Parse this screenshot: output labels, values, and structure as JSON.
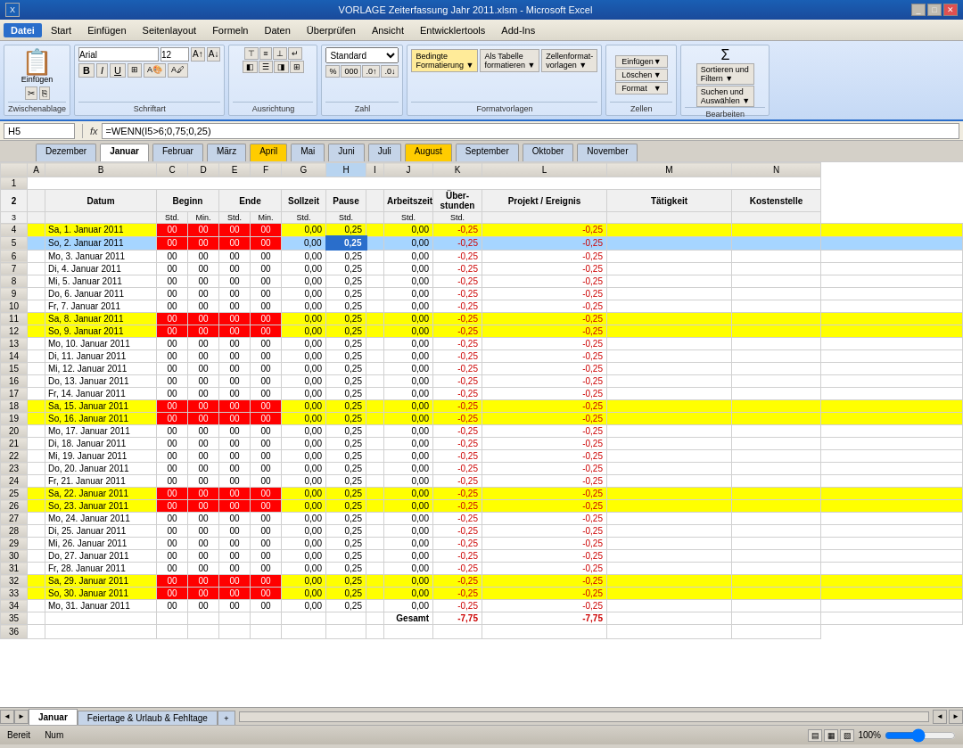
{
  "titleBar": {
    "title": "VORLAGE Zeiterfassung Jahr 2011.xlsm - Microsoft Excel",
    "controls": [
      "_",
      "□",
      "✕"
    ]
  },
  "menuBar": {
    "items": [
      "Datei",
      "Start",
      "Einfügen",
      "Seitenlayout",
      "Formeln",
      "Daten",
      "Überprüfen",
      "Ansicht",
      "Entwicklertools",
      "Add-Ins"
    ],
    "activeItem": "Datei"
  },
  "ribbonGroups": [
    {
      "label": "Zwischenablage",
      "buttons": [
        "Einfügen",
        "Ausschneiden",
        "Kopieren"
      ]
    },
    {
      "label": "Schriftart",
      "buttons": [
        "Arial",
        "12"
      ]
    },
    {
      "label": "Ausrichtung"
    },
    {
      "label": "Zahl",
      "buttons": [
        "Standard"
      ]
    },
    {
      "label": "Formatvorlagen",
      "buttons": [
        "Bedingte Formatierung",
        "Als Tabelle formatieren",
        "Zellenformatvorlagen"
      ]
    },
    {
      "label": "Zellen",
      "buttons": [
        "Einfügen",
        "Löschen",
        "Format"
      ]
    },
    {
      "label": "Bearbeiten",
      "buttons": [
        "Sortieren und Filtern",
        "Suchen und Auswählen"
      ]
    }
  ],
  "formulaBar": {
    "nameBox": "H5",
    "formula": "=WENN(I5>6;0,75;0,25)"
  },
  "innerTabs": [
    {
      "label": "Dezember",
      "active": false
    },
    {
      "label": "Januar",
      "active": true
    },
    {
      "label": "Februar",
      "active": false
    },
    {
      "label": "März",
      "active": false
    },
    {
      "label": "April",
      "active": false,
      "highlight": true
    },
    {
      "label": "Mai",
      "active": false
    },
    {
      "label": "Juni",
      "active": false
    },
    {
      "label": "Juli",
      "active": false
    },
    {
      "label": "August",
      "active": false,
      "highlight": true
    },
    {
      "label": "September",
      "active": false
    },
    {
      "label": "Oktober",
      "active": false
    },
    {
      "label": "November",
      "active": false
    }
  ],
  "columns": {
    "rowNum": "#",
    "a": "A",
    "b": "B",
    "c": "C",
    "d": "D",
    "e": "E",
    "f": "F",
    "g": "G",
    "h": "H",
    "i": "I",
    "j": "J",
    "k": "K",
    "l": "L",
    "m": "M",
    "n": "N"
  },
  "tableHeaders": {
    "row1": {
      "datum": "Datum",
      "beginn": "Beginn",
      "ende": "Ende",
      "sollzeit": "Sollzeit",
      "pause": "Pause",
      "arbeitszeit": "Arbeitszeit",
      "ueberstunden": "Über-stunden",
      "projekt": "Projekt / Ereignis",
      "taetigkeit": "Tätigkeit",
      "kostenstelle": "Kostenstelle"
    },
    "row2": {
      "std1": "Std.",
      "min1": "Min.",
      "std2": "Std.",
      "min2": "Min.",
      "std3": "Std.",
      "pause_std": "Std.",
      "arb_std": "Std.",
      "ueber_std": "Std."
    }
  },
  "rows": [
    {
      "num": 4,
      "datum": "Sa, 1. Januar 2011",
      "b": "00",
      "c": "00",
      "d": "00",
      "e": "00",
      "f": "0,00",
      "g": "0,25",
      "h": "0,00",
      "i": "-0,25",
      "j": "-0,25",
      "type": "yellow"
    },
    {
      "num": 5,
      "datum": "So, 2. Januar 2011",
      "b": "00",
      "c": "00",
      "d": "00",
      "e": "00",
      "f": "0,00",
      "g": "0,25",
      "h": "0,00",
      "i": "-0,25",
      "j": "-0,25",
      "type": "selected"
    },
    {
      "num": 6,
      "datum": "Mo, 3. Januar 2011",
      "b": "00",
      "c": "00",
      "d": "00",
      "e": "00",
      "f": "0,00",
      "g": "0,25",
      "h": "0,00",
      "i": "-0,25",
      "j": "-0,25",
      "type": "normal"
    },
    {
      "num": 7,
      "datum": "Di, 4. Januar 2011",
      "b": "00",
      "c": "00",
      "d": "00",
      "e": "00",
      "f": "0,00",
      "g": "0,25",
      "h": "0,00",
      "i": "-0,25",
      "j": "-0,25",
      "type": "normal"
    },
    {
      "num": 8,
      "datum": "Mi, 5. Januar 2011",
      "b": "00",
      "c": "00",
      "d": "00",
      "e": "00",
      "f": "0,00",
      "g": "0,25",
      "h": "0,00",
      "i": "-0,25",
      "j": "-0,25",
      "type": "normal"
    },
    {
      "num": 9,
      "datum": "Do, 6. Januar 2011",
      "b": "00",
      "c": "00",
      "d": "00",
      "e": "00",
      "f": "0,00",
      "g": "0,25",
      "h": "0,00",
      "i": "-0,25",
      "j": "-0,25",
      "type": "normal"
    },
    {
      "num": 10,
      "datum": "Fr, 7. Januar 2011",
      "b": "00",
      "c": "00",
      "d": "00",
      "e": "00",
      "f": "0,00",
      "g": "0,25",
      "h": "0,00",
      "i": "-0,25",
      "j": "-0,25",
      "type": "normal"
    },
    {
      "num": 11,
      "datum": "Sa, 8. Januar 2011",
      "b": "00",
      "c": "00",
      "d": "00",
      "e": "00",
      "f": "0,00",
      "g": "0,25",
      "h": "0,00",
      "i": "-0,25",
      "j": "-0,25",
      "type": "yellow"
    },
    {
      "num": 12,
      "datum": "So, 9. Januar 2011",
      "b": "00",
      "c": "00",
      "d": "00",
      "e": "00",
      "f": "0,00",
      "g": "0,25",
      "h": "0,00",
      "i": "-0,25",
      "j": "-0,25",
      "type": "yellow"
    },
    {
      "num": 13,
      "datum": "Mo, 10. Januar 2011",
      "b": "00",
      "c": "00",
      "d": "00",
      "e": "00",
      "f": "0,00",
      "g": "0,25",
      "h": "0,00",
      "i": "-0,25",
      "j": "-0,25",
      "type": "normal"
    },
    {
      "num": 14,
      "datum": "Di, 11. Januar 2011",
      "b": "00",
      "c": "00",
      "d": "00",
      "e": "00",
      "f": "0,00",
      "g": "0,25",
      "h": "0,00",
      "i": "-0,25",
      "j": "-0,25",
      "type": "normal"
    },
    {
      "num": 15,
      "datum": "Mi, 12. Januar 2011",
      "b": "00",
      "c": "00",
      "d": "00",
      "e": "00",
      "f": "0,00",
      "g": "0,25",
      "h": "0,00",
      "i": "-0,25",
      "j": "-0,25",
      "type": "normal"
    },
    {
      "num": 16,
      "datum": "Do, 13. Januar 2011",
      "b": "00",
      "c": "00",
      "d": "00",
      "e": "00",
      "f": "0,00",
      "g": "0,25",
      "h": "0,00",
      "i": "-0,25",
      "j": "-0,25",
      "type": "normal"
    },
    {
      "num": 17,
      "datum": "Fr, 14. Januar 2011",
      "b": "00",
      "c": "00",
      "d": "00",
      "e": "00",
      "f": "0,00",
      "g": "0,25",
      "h": "0,00",
      "i": "-0,25",
      "j": "-0,25",
      "type": "normal"
    },
    {
      "num": 18,
      "datum": "Sa, 15. Januar 2011",
      "b": "00",
      "c": "00",
      "d": "00",
      "e": "00",
      "f": "0,00",
      "g": "0,25",
      "h": "0,00",
      "i": "-0,25",
      "j": "-0,25",
      "type": "yellow"
    },
    {
      "num": 19,
      "datum": "So, 16. Januar 2011",
      "b": "00",
      "c": "00",
      "d": "00",
      "e": "00",
      "f": "0,00",
      "g": "0,25",
      "h": "0,00",
      "i": "-0,25",
      "j": "-0,25",
      "type": "yellow"
    },
    {
      "num": 20,
      "datum": "Mo, 17. Januar 2011",
      "b": "00",
      "c": "00",
      "d": "00",
      "e": "00",
      "f": "0,00",
      "g": "0,25",
      "h": "0,00",
      "i": "-0,25",
      "j": "-0,25",
      "type": "normal"
    },
    {
      "num": 21,
      "datum": "Di, 18. Januar 2011",
      "b": "00",
      "c": "00",
      "d": "00",
      "e": "00",
      "f": "0,00",
      "g": "0,25",
      "h": "0,00",
      "i": "-0,25",
      "j": "-0,25",
      "type": "normal"
    },
    {
      "num": 22,
      "datum": "Mi, 19. Januar 2011",
      "b": "00",
      "c": "00",
      "d": "00",
      "e": "00",
      "f": "0,00",
      "g": "0,25",
      "h": "0,00",
      "i": "-0,25",
      "j": "-0,25",
      "type": "normal"
    },
    {
      "num": 23,
      "datum": "Do, 20. Januar 2011",
      "b": "00",
      "c": "00",
      "d": "00",
      "e": "00",
      "f": "0,00",
      "g": "0,25",
      "h": "0,00",
      "i": "-0,25",
      "j": "-0,25",
      "type": "normal"
    },
    {
      "num": 24,
      "datum": "Fr, 21. Januar 2011",
      "b": "00",
      "c": "00",
      "d": "00",
      "e": "00",
      "f": "0,00",
      "g": "0,25",
      "h": "0,00",
      "i": "-0,25",
      "j": "-0,25",
      "type": "normal"
    },
    {
      "num": 25,
      "datum": "Sa, 22. Januar 2011",
      "b": "00",
      "c": "00",
      "d": "00",
      "e": "00",
      "f": "0,00",
      "g": "0,25",
      "h": "0,00",
      "i": "-0,25",
      "j": "-0,25",
      "type": "yellow"
    },
    {
      "num": 26,
      "datum": "So, 23. Januar 2011",
      "b": "00",
      "c": "00",
      "d": "00",
      "e": "00",
      "f": "0,00",
      "g": "0,25",
      "h": "0,00",
      "i": "-0,25",
      "j": "-0,25",
      "type": "yellow"
    },
    {
      "num": 27,
      "datum": "Mo, 24. Januar 2011",
      "b": "00",
      "c": "00",
      "d": "00",
      "e": "00",
      "f": "0,00",
      "g": "0,25",
      "h": "0,00",
      "i": "-0,25",
      "j": "-0,25",
      "type": "normal"
    },
    {
      "num": 28,
      "datum": "Di, 25. Januar 2011",
      "b": "00",
      "c": "00",
      "d": "00",
      "e": "00",
      "f": "0,00",
      "g": "0,25",
      "h": "0,00",
      "i": "-0,25",
      "j": "-0,25",
      "type": "normal"
    },
    {
      "num": 29,
      "datum": "Mi, 26. Januar 2011",
      "b": "00",
      "c": "00",
      "d": "00",
      "e": "00",
      "f": "0,00",
      "g": "0,25",
      "h": "0,00",
      "i": "-0,25",
      "j": "-0,25",
      "type": "normal"
    },
    {
      "num": 30,
      "datum": "Do, 27. Januar 2011",
      "b": "00",
      "c": "00",
      "d": "00",
      "e": "00",
      "f": "0,00",
      "g": "0,25",
      "h": "0,00",
      "i": "-0,25",
      "j": "-0,25",
      "type": "normal"
    },
    {
      "num": 31,
      "datum": "Fr, 28. Januar 2011",
      "b": "00",
      "c": "00",
      "d": "00",
      "e": "00",
      "f": "0,00",
      "g": "0,25",
      "h": "0,00",
      "i": "-0,25",
      "j": "-0,25",
      "type": "normal"
    },
    {
      "num": 32,
      "datum": "Sa, 29. Januar 2011",
      "b": "00",
      "c": "00",
      "d": "00",
      "e": "00",
      "f": "0,00",
      "g": "0,25",
      "h": "0,00",
      "i": "-0,25",
      "j": "-0,25",
      "type": "yellow"
    },
    {
      "num": 33,
      "datum": "So, 30. Januar 2011",
      "b": "00",
      "c": "00",
      "d": "00",
      "e": "00",
      "f": "0,00",
      "g": "0,25",
      "h": "0,00",
      "i": "-0,25",
      "j": "-0,25",
      "type": "yellow"
    },
    {
      "num": 34,
      "datum": "Mo, 31. Januar 2011",
      "b": "00",
      "c": "00",
      "d": "00",
      "e": "00",
      "f": "0,00",
      "g": "0,25",
      "h": "0,00",
      "i": "-0,25",
      "j": "-0,25",
      "type": "normal"
    }
  ],
  "totalRow": {
    "label": "Gesamt",
    "arbeitszeit": "-7,75",
    "ueberstunden": "-7,75"
  },
  "sheetTabs": [
    {
      "label": "Januar",
      "active": true
    },
    {
      "label": "Feiertage & Urlaub & Fehltage",
      "active": false
    }
  ],
  "statusBar": {
    "left": "Bereit",
    "num": "Num",
    "zoom": "100%"
  }
}
